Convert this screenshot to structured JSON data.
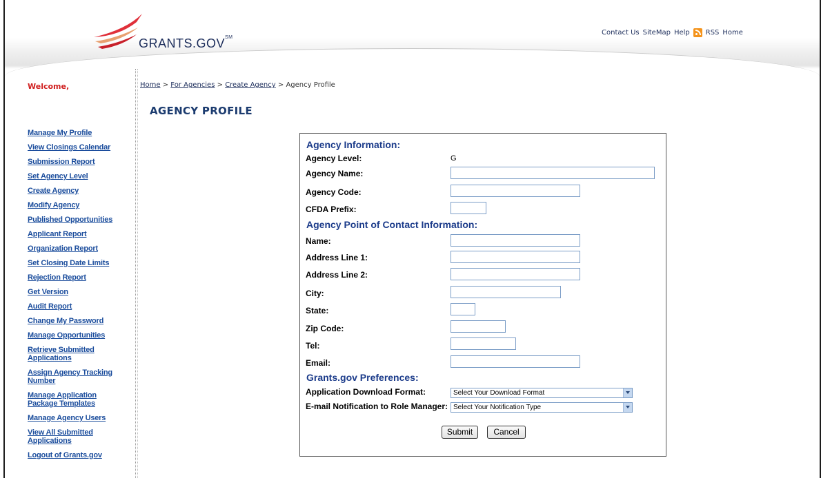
{
  "header": {
    "logo_text": "GRANTS.GOV",
    "logo_mark": "SM",
    "links": {
      "contact": "Contact Us",
      "sitemap": "SiteMap",
      "help": "Help",
      "rss": "RSS",
      "home": "Home"
    }
  },
  "welcome": "Welcome,",
  "sidebar": {
    "items": [
      {
        "label": "Manage My Profile"
      },
      {
        "label": "View Closings Calendar"
      },
      {
        "label": "Submission Report"
      },
      {
        "label": "Set Agency Level"
      },
      {
        "label": "Create Agency"
      },
      {
        "label": "Modify Agency"
      },
      {
        "label": "Published Opportunities"
      },
      {
        "label": "Applicant Report"
      },
      {
        "label": "Organization Report"
      },
      {
        "label": "Set Closing Date Limits"
      },
      {
        "label": "Rejection Report"
      },
      {
        "label": "Get Version"
      },
      {
        "label": "Audit Report"
      },
      {
        "label": "Change My Password"
      },
      {
        "label": "Manage Opportunities"
      },
      {
        "label": "Retrieve Submitted Applications"
      },
      {
        "label": "Assign Agency Tracking Number"
      },
      {
        "label": "Manage Application Package Templates"
      },
      {
        "label": "Manage Agency Users"
      },
      {
        "label": "View All Submitted Applications"
      },
      {
        "label": "Logout of Grants.gov"
      }
    ]
  },
  "breadcrumb": {
    "home": "Home",
    "for_agencies": "For Agencies",
    "create_agency": "Create Agency",
    "current": "Agency Profile",
    "sep": ">"
  },
  "page_title": "AGENCY PROFILE",
  "form": {
    "agency_info_title": "Agency Information:",
    "agency_level_label": "Agency Level:",
    "agency_level_value": "G",
    "agency_name_label": "Agency Name:",
    "agency_code_label": "Agency Code:",
    "cfda_prefix_label": "CFDA Prefix:",
    "poc_title": "Agency Point of Contact Information:",
    "name_label": "Name:",
    "address1_label": "Address Line 1:",
    "address2_label": "Address Line 2:",
    "city_label": "City:",
    "state_label": "State:",
    "zip_label": "Zip Code:",
    "tel_label": "Tel:",
    "email_label": "Email:",
    "prefs_title": "Grants.gov Preferences:",
    "download_format_label": "Application Download Format:",
    "download_format_value": "Select Your Download Format",
    "notification_label": "E-mail Notification to Role Manager:",
    "notification_value": "Select Your Notification Type",
    "submit_label": "Submit",
    "cancel_label": "Cancel"
  },
  "colors": {
    "link": "#1a4c9c",
    "title": "#1b3b6f",
    "welcome": "#d02020",
    "section": "#1b3b8a"
  }
}
